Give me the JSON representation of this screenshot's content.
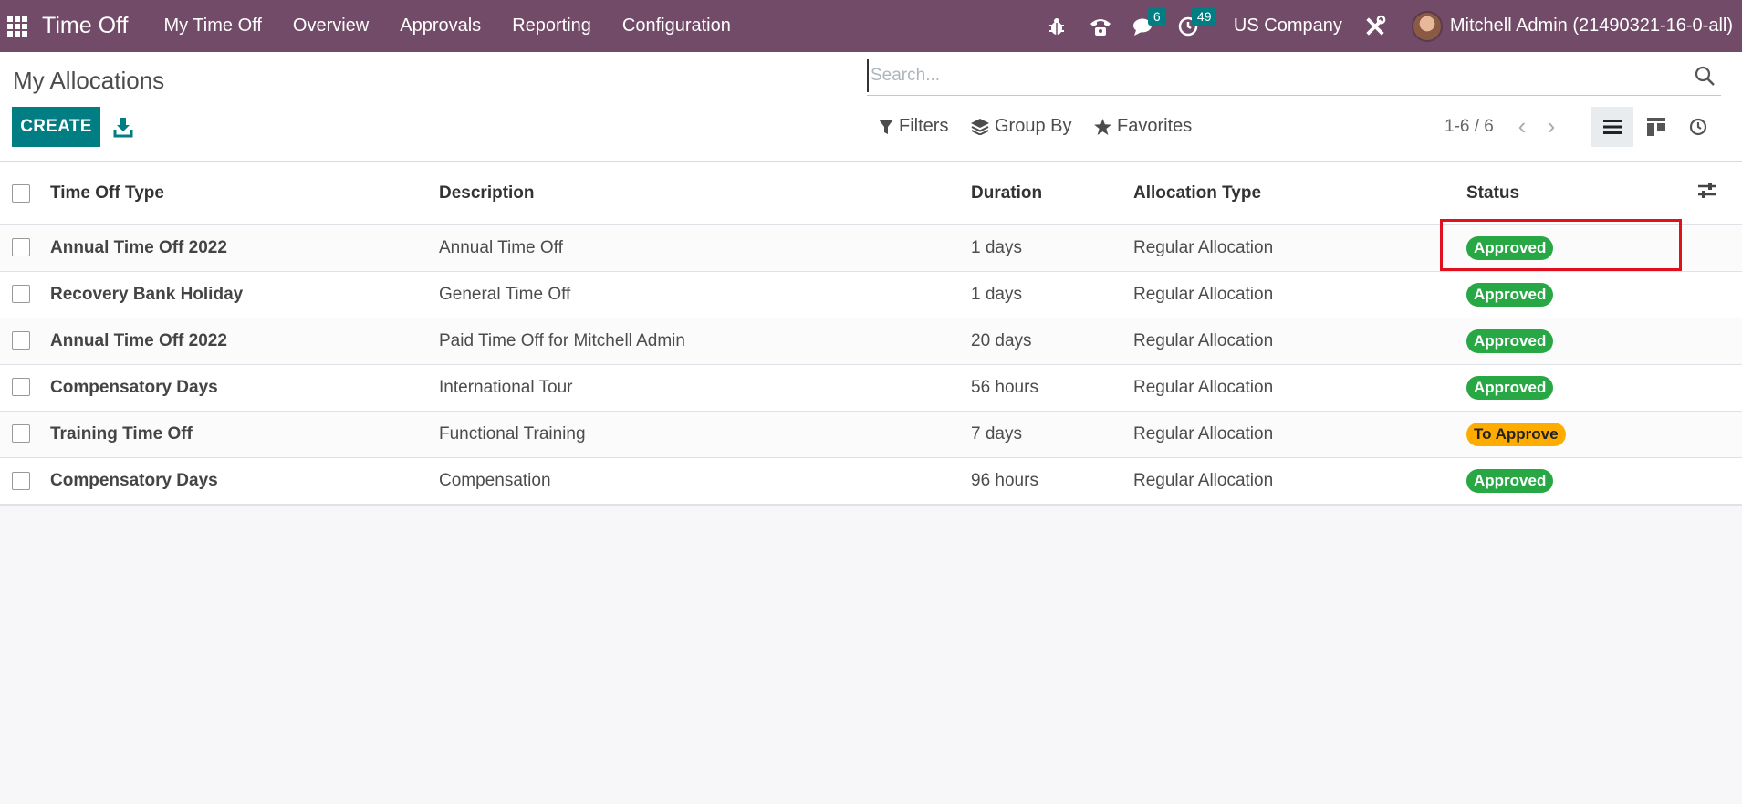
{
  "navbar": {
    "app_title": "Time Off",
    "menu": [
      "My Time Off",
      "Overview",
      "Approvals",
      "Reporting",
      "Configuration"
    ],
    "messages_count": "6",
    "activities_count": "49",
    "company": "US Company",
    "user": "Mitchell Admin (21490321-16-0-all)"
  },
  "control": {
    "page_title": "My Allocations",
    "create_label": "CREATE",
    "search_placeholder": "Search...",
    "filters_label": "Filters",
    "group_by_label": "Group By",
    "favorites_label": "Favorites",
    "pager": "1-6 / 6"
  },
  "table": {
    "headers": {
      "type": "Time Off Type",
      "description": "Description",
      "duration": "Duration",
      "allocation_type": "Allocation Type",
      "status": "Status"
    },
    "rows": [
      {
        "type": "Annual Time Off 2022",
        "description": "Annual Time Off",
        "duration": "1 days",
        "allocation_type": "Regular Allocation",
        "status": "Approved"
      },
      {
        "type": "Recovery Bank Holiday",
        "description": "General Time Off",
        "duration": "1 days",
        "allocation_type": "Regular Allocation",
        "status": "Approved"
      },
      {
        "type": "Annual Time Off 2022",
        "description": "Paid Time Off for Mitchell Admin",
        "duration": "20 days",
        "allocation_type": "Regular Allocation",
        "status": "Approved"
      },
      {
        "type": "Compensatory Days",
        "description": "International Tour",
        "duration": "56 hours",
        "allocation_type": "Regular Allocation",
        "status": "Approved"
      },
      {
        "type": "Training Time Off",
        "description": "Functional Training",
        "duration": "7 days",
        "allocation_type": "Regular Allocation",
        "status": "To Approve"
      },
      {
        "type": "Compensatory Days",
        "description": "Compensation",
        "duration": "96 hours",
        "allocation_type": "Regular Allocation",
        "status": "Approved"
      }
    ]
  },
  "colors": {
    "navbar": "#714b67",
    "primary": "#017e84",
    "approved": "#28a745",
    "to_approve": "#ffac00",
    "highlight": "#e0101e"
  },
  "icons": [
    "apps-icon",
    "download-icon",
    "search-icon",
    "filter-icon",
    "layers-icon",
    "star-icon",
    "bug-icon",
    "phone-icon",
    "chat-icon",
    "clock-icon",
    "tools-icon",
    "list-view-icon",
    "kanban-view-icon",
    "activity-view-icon",
    "optional-columns-icon"
  ]
}
